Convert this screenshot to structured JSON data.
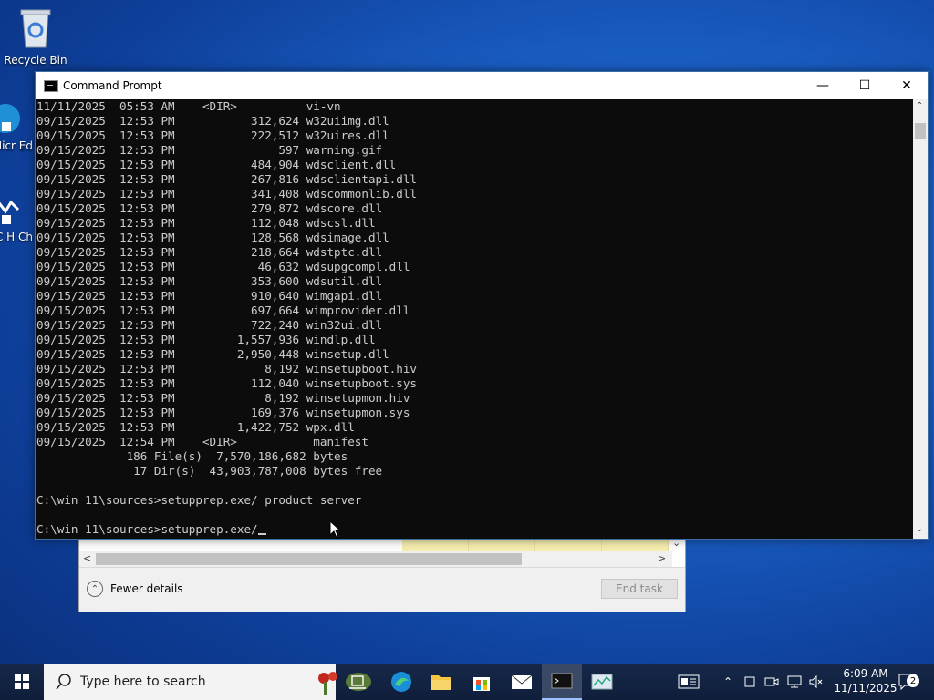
{
  "desktop": {
    "icons": [
      {
        "label": "Recycle Bin"
      },
      {
        "label": "Micr Ed"
      },
      {
        "label": "PC H Ch"
      }
    ]
  },
  "cmd": {
    "title": "Command Prompt",
    "lines": [
      "11/11/2025  05:53 AM    <DIR>          vi-vn",
      "09/15/2025  12:53 PM           312,624 w32uiimg.dll",
      "09/15/2025  12:53 PM           222,512 w32uires.dll",
      "09/15/2025  12:53 PM               597 warning.gif",
      "09/15/2025  12:53 PM           484,904 wdsclient.dll",
      "09/15/2025  12:53 PM           267,816 wdsclientapi.dll",
      "09/15/2025  12:53 PM           341,408 wdscommonlib.dll",
      "09/15/2025  12:53 PM           279,872 wdscore.dll",
      "09/15/2025  12:53 PM           112,048 wdscsl.dll",
      "09/15/2025  12:53 PM           128,568 wdsimage.dll",
      "09/15/2025  12:53 PM           218,664 wdstptc.dll",
      "09/15/2025  12:53 PM            46,632 wdsupgcompl.dll",
      "09/15/2025  12:53 PM           353,600 wdsutil.dll",
      "09/15/2025  12:53 PM           910,640 wimgapi.dll",
      "09/15/2025  12:53 PM           697,664 wimprovider.dll",
      "09/15/2025  12:53 PM           722,240 win32ui.dll",
      "09/15/2025  12:53 PM         1,557,936 windlp.dll",
      "09/15/2025  12:53 PM         2,950,448 winsetup.dll",
      "09/15/2025  12:53 PM             8,192 winsetupboot.hiv",
      "09/15/2025  12:53 PM           112,040 winsetupboot.sys",
      "09/15/2025  12:53 PM             8,192 winsetupmon.hiv",
      "09/15/2025  12:53 PM           169,376 winsetupmon.sys",
      "09/15/2025  12:53 PM         1,422,752 wpx.dll",
      "09/15/2025  12:54 PM    <DIR>          _manifest",
      "             186 File(s)  7,570,186,682 bytes",
      "              17 Dir(s)  43,903,787,008 bytes free",
      "",
      "C:\\win 11\\sources>setupprep.exe/ product server",
      "",
      "C:\\win 11\\sources>setupprep.exe/"
    ]
  },
  "taskmgr": {
    "fewer_details": "Fewer details",
    "end_task": "End task"
  },
  "taskbar": {
    "search_placeholder": "Type here to search",
    "time": "6:09 AM",
    "date": "11/11/2025",
    "notification_count": "2"
  }
}
